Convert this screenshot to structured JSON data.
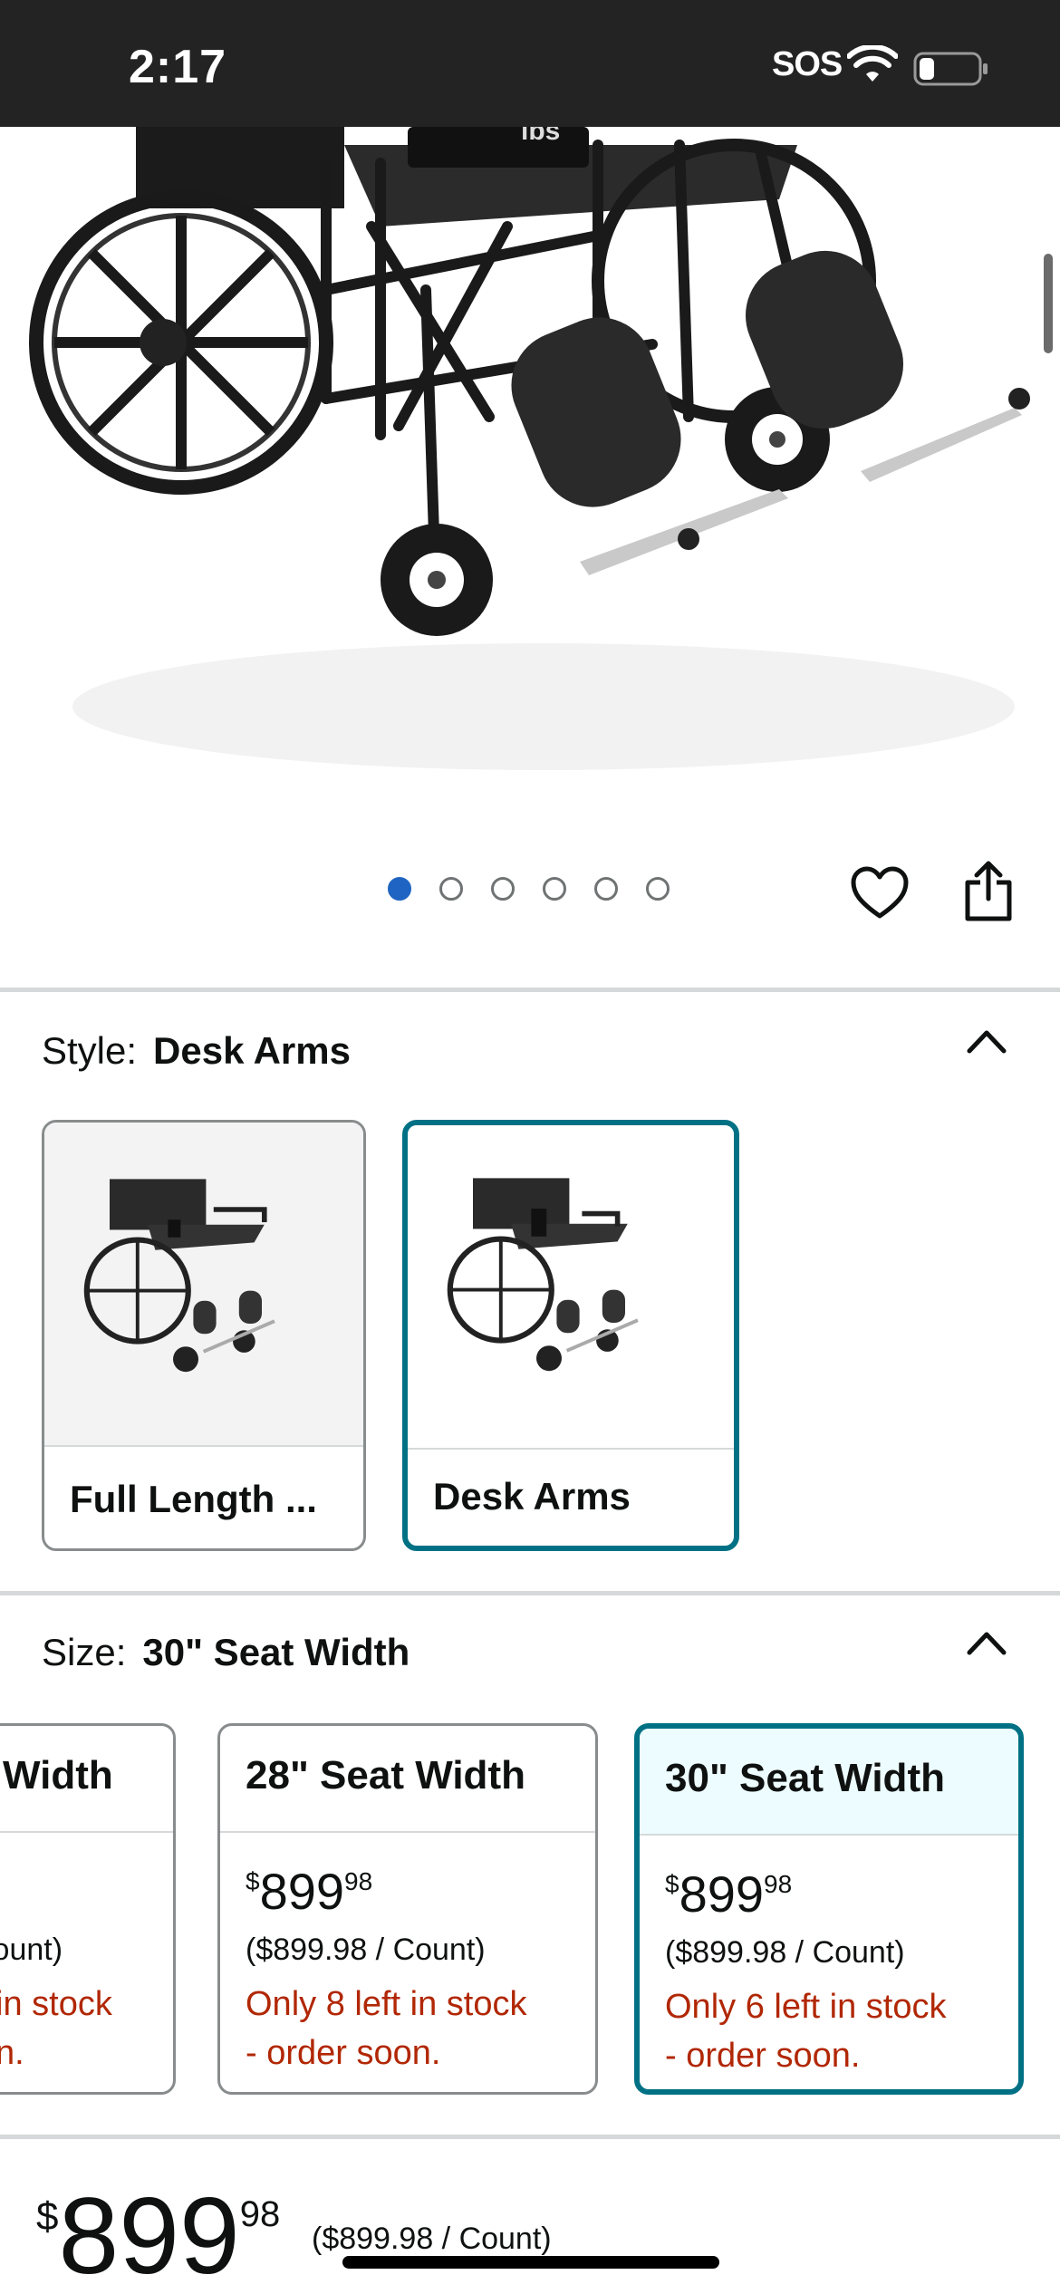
{
  "status_bar": {
    "time": "2:17",
    "sos": "SOS",
    "battery_level": 0.25
  },
  "hero": {
    "image": "wheelchair-product-image",
    "badge_text": "lbs",
    "carousel_dots": 6,
    "active_dot": 0
  },
  "style": {
    "key": "Style:",
    "selected": "Desk Arms",
    "options": [
      {
        "label": "Full Length ...",
        "selected": false
      },
      {
        "label": "Desk Arms",
        "selected": true
      }
    ]
  },
  "size": {
    "key": "Size:",
    "selected": "30\" Seat Width",
    "options": [
      {
        "label": "Width",
        "currency": "$",
        "whole": "",
        "fraction": "",
        "unit": "Count)",
        "stock_line1": "in stock",
        "stock_line2": "n.",
        "selected": false
      },
      {
        "label": "28\" Seat Width",
        "currency": "$",
        "whole": "899",
        "fraction": "98",
        "unit": "($899.98 / Count)",
        "stock_line1": "Only 8 left in stock",
        "stock_line2": "- order soon.",
        "selected": false
      },
      {
        "label": "30\" Seat Width",
        "currency": "$",
        "whole": "899",
        "fraction": "98",
        "unit": "($899.98 / Count)",
        "stock_line1": "Only 6 left in stock",
        "stock_line2": "- order soon.",
        "selected": true
      }
    ]
  },
  "price": {
    "currency": "$",
    "whole": "899",
    "fraction": "98",
    "unit": "($899.98 / Count)"
  },
  "colors": {
    "accent": "#007185",
    "stock_red": "#b12704",
    "dot_active": "#1f64c2"
  }
}
